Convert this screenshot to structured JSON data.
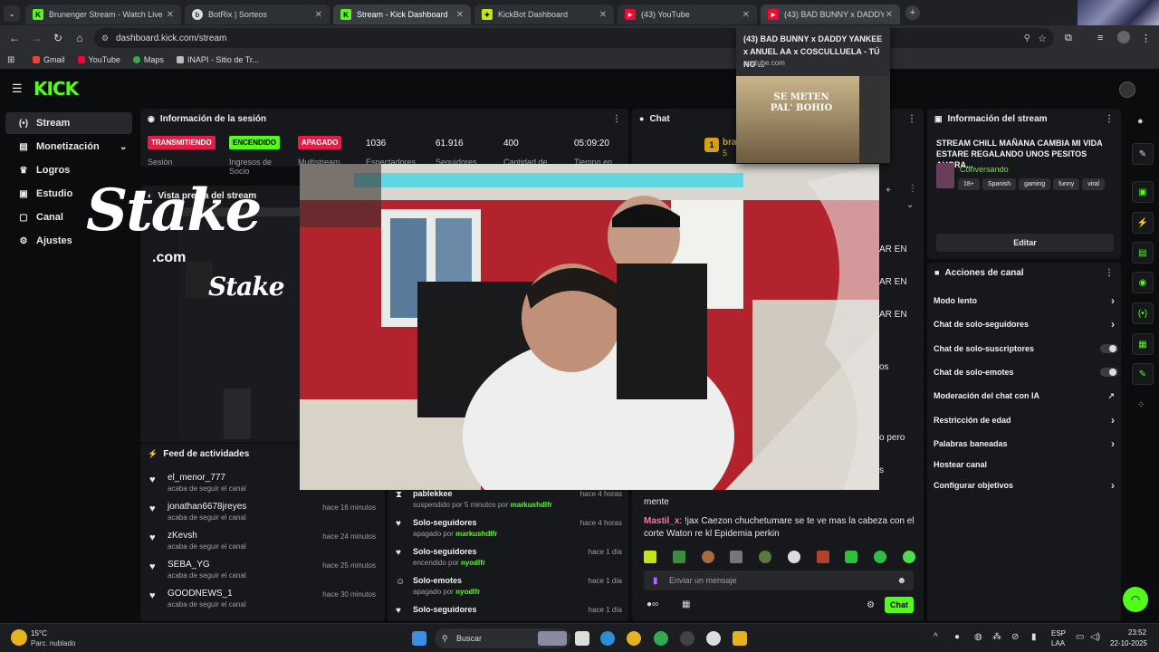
{
  "tabs": [
    {
      "title": "Brunenger Stream - Watch Live",
      "active": false,
      "icon": "kick-icon"
    },
    {
      "title": "BotRix | Sorteos",
      "active": false,
      "icon": "botrix-icon"
    },
    {
      "title": "Stream - Kick Dashboard",
      "active": true,
      "icon": "kick-icon"
    },
    {
      "title": "KickBot Dashboard",
      "active": false,
      "icon": "kickbot-icon"
    },
    {
      "title": "(43) YouTube",
      "active": false,
      "icon": "youtube-icon"
    },
    {
      "title": "(43) BAD BUNNY x DADDY YANKEE",
      "active": false,
      "icon": "youtube-icon"
    }
  ],
  "url": "dashboard.kick.com/stream",
  "bookmarks": [
    "Gmail",
    "YouTube",
    "Maps",
    "INAPI - Sitio de Tr..."
  ],
  "hover_card": {
    "title": "(43) BAD BUNNY x DADDY YANKEE x ANUEL AA x COSCULLUELA - TÚ NO ...",
    "domain": "youtube.com",
    "thumb_text": "SE METEN PAL' BOHIO"
  },
  "sidebar": [
    {
      "label": "Stream",
      "icon": "broadcast-icon",
      "active": true
    },
    {
      "label": "Monetización",
      "icon": "dollar-icon",
      "active": false,
      "chevron": true
    },
    {
      "label": "Logros",
      "icon": "trophy-icon",
      "active": false
    },
    {
      "label": "Estudio",
      "icon": "camera-icon",
      "active": false
    },
    {
      "label": "Canal",
      "icon": "channel-icon",
      "active": false
    },
    {
      "label": "Ajustes",
      "icon": "gear-icon",
      "active": false
    }
  ],
  "session": {
    "title": "Información de la sesión",
    "badges": [
      {
        "label": "TRANSMITIENDO",
        "caption": "Sesión",
        "color": "#e11d48"
      },
      {
        "label": "ENCENDIDO",
        "caption": "Ingresos de Socio",
        "color": "#53fc18"
      },
      {
        "label": "APAGADO",
        "caption": "Multistream",
        "color": "#e11d48"
      }
    ],
    "stats": [
      {
        "value": "1036",
        "label": "Espectadores"
      },
      {
        "value": "61.916",
        "label": "Seguidores"
      },
      {
        "value": "400",
        "label": "Cantidad de"
      },
      {
        "value": "05:09:20",
        "label": "Tiempo en"
      }
    ]
  },
  "preview_title": "Vista previa del stream",
  "overlay_logo": "Stake",
  "overlay_sub": ".com",
  "chat_title": "Chat",
  "chat_partial": {
    "name": "bra",
    "chip": "5"
  },
  "chat_fragments": [
    "AR EN",
    "AR EN",
    "AR EN",
    "os",
    "o pero",
    "s"
  ],
  "chat_messages": [
    {
      "user": "",
      "text": "mente"
    },
    {
      "user": "Mastil_x",
      "text": ": !jax Caezon chuchetumare se te ve mas la cabeza con el corte Waton re kl Epidemia perkin"
    }
  ],
  "chat_input": {
    "placeholder": "Enviar un mensaje",
    "button": "Chat"
  },
  "activity": {
    "title": "Feed de actividades",
    "items": [
      {
        "name": "el_menor_777",
        "sub": "acaba de seguir el canal",
        "time": ""
      },
      {
        "name": "jonathan6678jreyes",
        "sub": "acaba de seguir el canal",
        "time": "hace 16 minutos"
      },
      {
        "name": "zKevsh",
        "sub": "acaba de seguir el canal",
        "time": "hace 24 minutos"
      },
      {
        "name": "SEBA_YG",
        "sub": "acaba de seguir el canal",
        "time": "hace 25 minutos"
      },
      {
        "name": "GOODNEWS_1",
        "sub": "acaba de seguir el canal",
        "time": "hace 30 minutos"
      }
    ]
  },
  "mod_log": [
    {
      "name": "pablekkee",
      "sub": "suspendido por 5 minutos por ",
      "by": "markushdlfr",
      "time": "hace 4 horas",
      "icon": "hourglass-icon"
    },
    {
      "name": "Solo-seguidores",
      "sub": "apagado por ",
      "by": "markushdlfr",
      "time": "hace 4 horas",
      "icon": "heart-icon"
    },
    {
      "name": "Solo-seguidores",
      "sub": "encendido por ",
      "by": "nyodlfr",
      "time": "hace 1 día",
      "icon": "heart-icon"
    },
    {
      "name": "Solo-emotes",
      "sub": "apagado por ",
      "by": "nyodlfr",
      "time": "hace 1 día",
      "icon": "smile-icon"
    },
    {
      "name": "Solo-seguidores",
      "sub": "",
      "by": "",
      "time": "hace 1 día",
      "icon": "heart-icon"
    }
  ],
  "stream_info": {
    "title": "Información del stream",
    "stream_title": "STREAM CHILL MAÑANA CAMBIA MI VIDA ESTARE REGALANDO UNOS PESITOS AHORA...",
    "category": "Conversando",
    "tags": [
      "18+",
      "Spanish",
      "gaming",
      "funny",
      "viral"
    ],
    "edit": "Editar"
  },
  "channel_actions": {
    "title": "Acciones de canal",
    "items": [
      {
        "label": "Modo lento",
        "control": "chevron"
      },
      {
        "label": "Chat de solo-seguidores",
        "control": "chevron"
      },
      {
        "label": "Chat de solo-suscriptores",
        "control": "toggle"
      },
      {
        "label": "Chat de solo-emotes",
        "control": "toggle"
      },
      {
        "label": "Moderación del chat con IA",
        "control": "external"
      },
      {
        "label": "Restricción de edad",
        "control": "chevron"
      },
      {
        "label": "Palabras baneadas",
        "control": "chevron"
      },
      {
        "label": "Hostear canal",
        "control": "none"
      },
      {
        "label": "Configurar objetivos",
        "control": "chevron"
      }
    ]
  },
  "taskbar": {
    "weather_temp": "15°C",
    "weather_desc": "Parc. nublado",
    "search": "Buscar",
    "lang": "ESP",
    "lang2": "LAA",
    "time": "23:52",
    "date": "22-10-2025"
  }
}
